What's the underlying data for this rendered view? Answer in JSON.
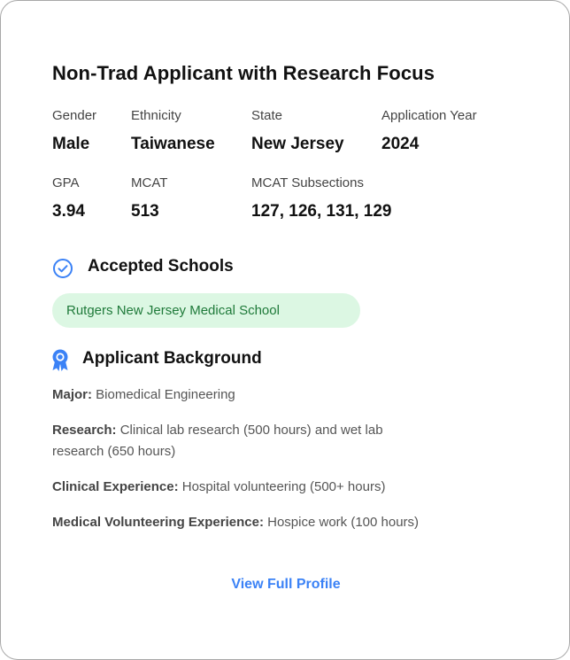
{
  "profile": {
    "title": "Non-Trad Applicant with Research Focus",
    "fields": {
      "gender": {
        "label": "Gender",
        "value": "Male"
      },
      "ethnicity": {
        "label": "Ethnicity",
        "value": "Taiwanese"
      },
      "state": {
        "label": "State",
        "value": "New Jersey"
      },
      "application_year": {
        "label": "Application Year",
        "value": "2024"
      },
      "gpa": {
        "label": "GPA",
        "value": "3.94"
      },
      "mcat": {
        "label": "MCAT",
        "value": "513"
      },
      "mcat_subsections": {
        "label": "MCAT Subsections",
        "value": "127, 126, 131, 129"
      }
    }
  },
  "accepted": {
    "title": "Accepted Schools",
    "icon": "check-circle-icon",
    "schools": [
      "Rutgers New Jersey Medical School"
    ]
  },
  "background": {
    "title": "Applicant Background",
    "icon": "award-ribbon-icon",
    "items": [
      {
        "label": "Major:",
        "text": " Biomedical Engineering"
      },
      {
        "label": "Research:",
        "text": " Clinical lab research (500 hours) and wet lab research (650 hours)"
      },
      {
        "label": "Clinical Experience:",
        "text": " Hospital volunteering (500+ hours)"
      },
      {
        "label": "Medical Volunteering Experience:",
        "text": " Hospice work (100 hours)"
      }
    ]
  },
  "actions": {
    "view_full_profile": "View Full Profile"
  },
  "colors": {
    "accent": "#3b82f6",
    "pill_bg": "#dcf7e3",
    "pill_text": "#1f7a3a"
  }
}
